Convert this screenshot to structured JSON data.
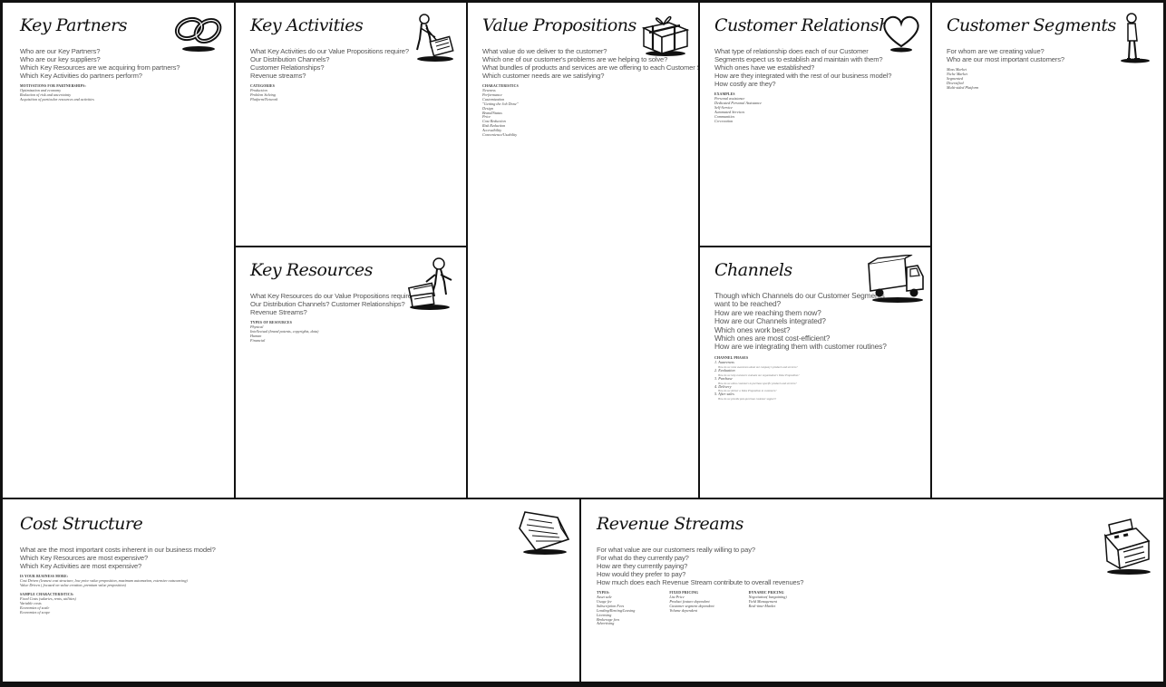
{
  "key_partners": {
    "title": "Key Partners",
    "icon": "chain-links-icon",
    "questions": [
      "Who are our Key Partners?",
      "Who are our key suppliers?",
      "Which Key Resources are we acquiring from partners?",
      "Which Key Activities do partners perform?"
    ],
    "subheading": "MOTIVATIONS FOR PARTNERSHIPS:",
    "items": [
      "Optimization and economy",
      "Reduction of risk and uncertainty",
      "Acquisition of particular resources and activities"
    ]
  },
  "key_activities": {
    "title": "Key Activities",
    "icon": "worker-icon",
    "questions": [
      "What Key Activities do our Value Propositions require?",
      "Our Distribution Channels?",
      "Customer Relationships?",
      "Revenue streams?"
    ],
    "subheading": "CATEGORIES",
    "items": [
      "Production",
      "Problem Solving",
      "Platform/Network"
    ]
  },
  "value_propositions": {
    "title": "Value Propositions",
    "icon": "gift-box-icon",
    "questions": [
      "What value do we deliver to the customer?",
      "Which one of our customer's problems are we helping to solve?",
      "What bundles of products and services are we offering to each Customer Segment?",
      "Which customer needs are we satisfying?"
    ],
    "subheading": "CHARACTERISTICS",
    "items": [
      "Newness",
      "Performance",
      "Customization",
      "\"Getting the Job Done\"",
      "Design",
      "Brand/Status",
      "Price",
      "Cost Reduction",
      "Risk Reduction",
      "Accessibility",
      "Convenience/Usability"
    ]
  },
  "customer_relationships": {
    "title": "Customer Relationships",
    "icon": "heart-icon",
    "questions": [
      "What type of relationship does each of our Customer",
      "Segments expect us to establish and maintain with them?",
      "Which ones have we established?",
      "How are they integrated with the rest of our business model?",
      "How costly are they?"
    ],
    "subheading": "EXAMPLES",
    "items": [
      "Personal assistance",
      "Dedicated Personal Assistance",
      "Self-Service",
      "Automated Services",
      "Communities",
      "Co-creation"
    ]
  },
  "customer_segments": {
    "title": "Customer Segments",
    "icon": "standing-person-icon",
    "questions": [
      "For whom are we creating value?",
      "Who are our most important customers?"
    ],
    "items": [
      "Mass Market",
      "Niche Market",
      "Segmented",
      "Diversified",
      "Multi-sided Platform"
    ]
  },
  "key_resources": {
    "title": "Key Resources",
    "icon": "worker-with-crates-icon",
    "questions": [
      "What Key Resources do our Value Propositions require?",
      "Our Distribution Channels? Customer Relationships?",
      "Revenue Streams?"
    ],
    "subheading": "TYPES OF RESOURCES",
    "items": [
      "Physical",
      "Intellectual (brand patents, copyrights, data)",
      "Human",
      "Financial"
    ]
  },
  "channels": {
    "title": "Channels",
    "icon": "delivery-truck-icon",
    "questions": [
      "Though which Channels do our Customer Segments",
      "want to be reached?",
      "How are we reaching them now?",
      "How are our Channels integrated?",
      "Which ones work best?",
      "Which ones are most cost-efficient?",
      "How are we integrating them with customer routines?"
    ],
    "subheading": "CHANNEL PHASES",
    "phases": [
      {
        "label": "1. Awareness",
        "detail": "How do we raise awareness about our company's products and services?"
      },
      {
        "label": "2. Evaluation",
        "detail": "How do we help customers evaluate our organization's Value Proposition?"
      },
      {
        "label": "3. Purchase",
        "detail": "How do we allow customers to purchase specific products and services?"
      },
      {
        "label": "4. Delivery",
        "detail": "How do we deliver a Value Proposition to customers?"
      },
      {
        "label": "5. After sales",
        "detail": "How do we provide post-purchase customer support?"
      }
    ]
  },
  "cost_structure": {
    "title": "Cost Structure",
    "icon": "document-icon",
    "questions": [
      "What are the most important costs inherent in our business model?",
      "Which Key Resources are most expensive?",
      "Which Key Activities are most expensive?"
    ],
    "subheading_1": "IS YOUR BUSINESS MORE:",
    "items_1": [
      "Cost Driven (leanest cost structure, low price value proposition, maximum automation, extensive outsourcing)",
      "Value Driven ( focused on value creation, premium value proposition)"
    ],
    "subheading_2": "SAMPLE CHARACTERISTICS:",
    "items_2": [
      "Fixed Costs (salaries, rents, utilities)",
      "Variable costs",
      "Economies of scale",
      "Economies of scope"
    ]
  },
  "revenue_streams": {
    "title": "Revenue Streams",
    "icon": "cash-register-icon",
    "questions": [
      "For what value are our customers really willing to pay?",
      "For what do they currently pay?",
      "How are they currently paying?",
      "How would they prefer to pay?",
      "How much does each Revenue Stream contribute to overall revenues?"
    ],
    "columns": [
      {
        "heading": "TYPES:",
        "items": [
          "Asset sale",
          "Usage fee",
          "Subscription Fees",
          "Lending/Renting/Leasing",
          "Licensing",
          "Brokerage fees",
          "Advertising"
        ]
      },
      {
        "heading": "FIXED PRICING",
        "items": [
          "List Price",
          "Product feature dependent",
          "Customer segment dependent",
          "Volume dependent"
        ]
      },
      {
        "heading": "DYNAMIC PRICING",
        "items": [
          "Negotiation( bargaining)",
          "Yield Management",
          "Real-time-Market"
        ]
      }
    ]
  }
}
